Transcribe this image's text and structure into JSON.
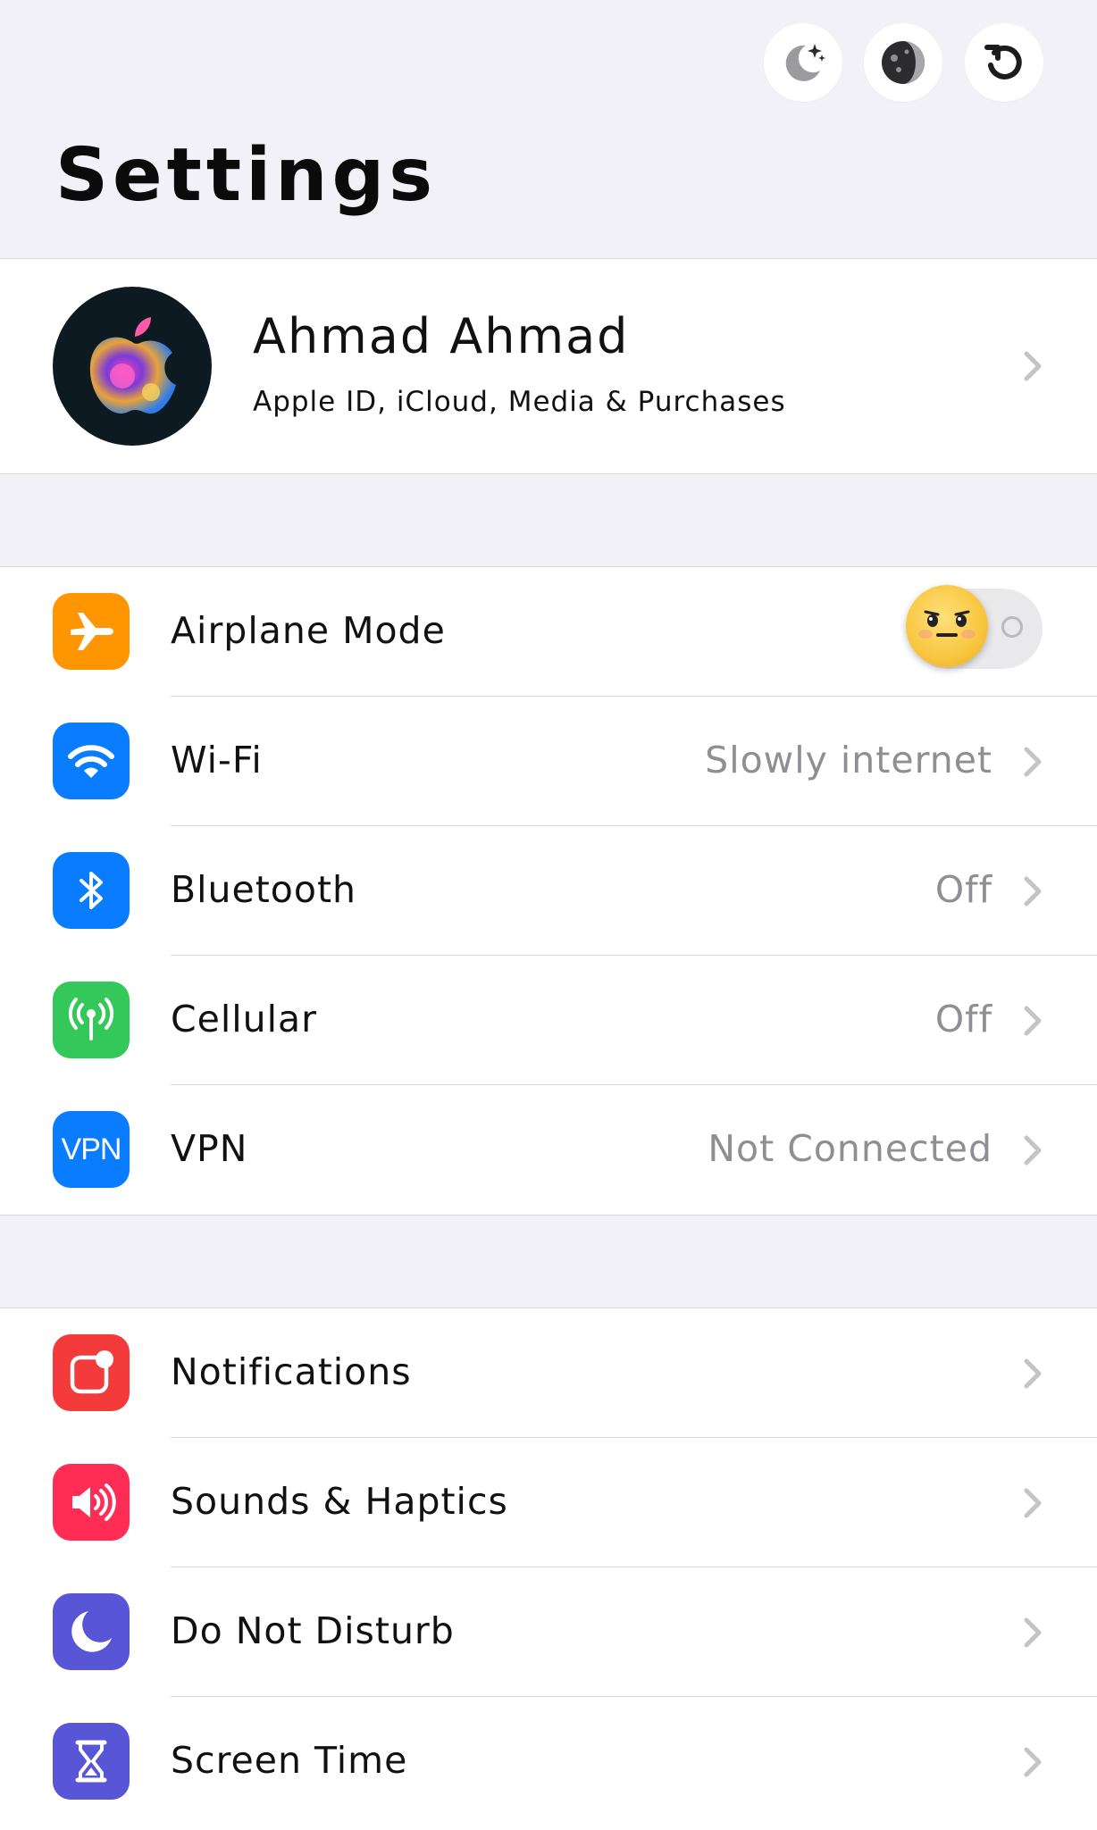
{
  "header": {
    "title": "Settings",
    "buttons": [
      {
        "name": "night-mode-icon"
      },
      {
        "name": "moon-phase-icon"
      },
      {
        "name": "refresh-icon"
      }
    ]
  },
  "profile": {
    "name": "Ahmad Ahmad",
    "subtitle": "Apple ID, iCloud, Media & Purchases",
    "avatar_icon": "apple-logo-icon"
  },
  "connectivity": [
    {
      "label": "Airplane Mode",
      "icon": "airplane-icon",
      "color": "#ff9500",
      "toggle": false
    },
    {
      "label": "Wi-Fi",
      "value": "Slowly internet",
      "icon": "wifi-icon",
      "color": "#0a7cff"
    },
    {
      "label": "Bluetooth",
      "value": "Off",
      "icon": "bluetooth-icon",
      "color": "#0a7cff"
    },
    {
      "label": "Cellular",
      "value": "Off",
      "icon": "cellular-icon",
      "color": "#34c759"
    },
    {
      "label": "VPN",
      "value": "Not Connected",
      "icon": "vpn-icon",
      "icon_text": "VPN",
      "color": "#0a7cff"
    }
  ],
  "general": [
    {
      "label": "Notifications",
      "icon": "notifications-icon",
      "color": "#f43b3b"
    },
    {
      "label": "Sounds & Haptics",
      "icon": "speaker-icon",
      "color": "#ff2d55"
    },
    {
      "label": "Do Not Disturb",
      "icon": "moon-icon",
      "color": "#5856d6"
    },
    {
      "label": "Screen Time",
      "icon": "hourglass-icon",
      "color": "#5856d6"
    }
  ]
}
